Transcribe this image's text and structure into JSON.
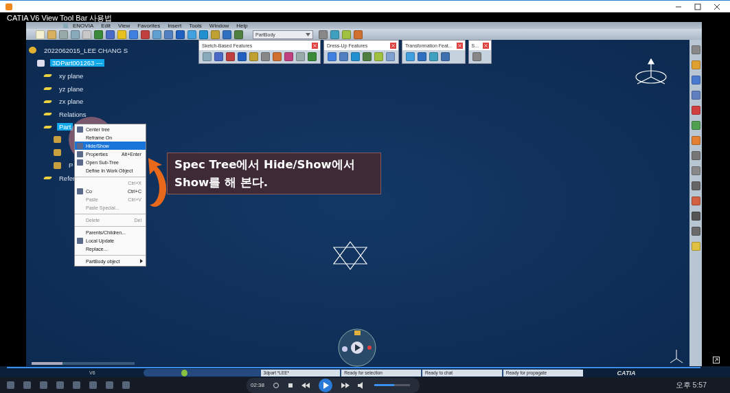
{
  "player": {
    "caption": "CATIA V6 View Tool Bar 사용법"
  },
  "menu_bar": [
    "ENOVIA",
    "Edit",
    "View",
    "Favorites",
    "Insert",
    "Tools",
    "Window",
    "Help"
  ],
  "toolbar": {
    "dropdown": "PartBody"
  },
  "floating_toolbars": [
    {
      "title": "Sketch-Based Features"
    },
    {
      "title": "Dress-Up Features"
    },
    {
      "title": "Transformation Feat..."
    },
    {
      "title": "S..."
    }
  ],
  "tree": {
    "label": "2022062015_LEE CHANG S",
    "selected": false,
    "children": [
      {
        "label": "3DPart001263 ---",
        "selected": true,
        "children": [
          {
            "label": "xy plane",
            "selected": false
          },
          {
            "label": "yz plane",
            "selected": false
          },
          {
            "label": "zx plane",
            "selected": false
          },
          {
            "label": "Relations",
            "selected": false
          },
          {
            "label": "Part",
            "selected": true,
            "children": [
              {
                "selected": false
              },
              {
                "selected": false
              },
              {
                "label": "P",
                "selected": false
              }
            ]
          },
          {
            "label": "Refer",
            "selected": false
          }
        ]
      }
    ]
  },
  "context_menu": [
    {
      "label": "Center tree",
      "icon": true,
      "selected": false,
      "disabled": false,
      "separator_before": false,
      "submenu": false
    },
    {
      "label": "Reframe On",
      "icon": false,
      "selected": false,
      "disabled": false,
      "separator_before": false,
      "submenu": false
    },
    {
      "label": "Hide/Show",
      "icon": true,
      "selected": true,
      "disabled": false,
      "separator_before": false,
      "submenu": false
    },
    {
      "label": "Properties",
      "shortcut": "Alt+Enter",
      "icon": true,
      "selected": false,
      "disabled": false,
      "separator_before": false,
      "submenu": false
    },
    {
      "label": "Open Sub-Tree",
      "icon": true,
      "selected": false,
      "disabled": false,
      "separator_before": false,
      "submenu": false
    },
    {
      "label": "Define In Work Object",
      "icon": false,
      "selected": false,
      "disabled": false,
      "separator_before": false,
      "submenu": false
    },
    {
      "shortcut": "Ctrl+X",
      "icon": false,
      "selected": false,
      "disabled": true,
      "separator_before": true,
      "submenu": false
    },
    {
      "label": "Co",
      "shortcut": "Ctrl+C",
      "icon": true,
      "selected": false,
      "disabled": false,
      "separator_before": false,
      "submenu": false
    },
    {
      "label": "Paste",
      "shortcut": "Ctrl+V",
      "icon": false,
      "selected": false,
      "disabled": true,
      "separator_before": false,
      "submenu": false
    },
    {
      "label": "Paste Special...",
      "icon": false,
      "selected": false,
      "disabled": true,
      "separator_before": false,
      "submenu": false
    },
    {
      "label": "Delete",
      "shortcut": "Del",
      "icon": false,
      "selected": false,
      "disabled": true,
      "separator_before": true,
      "submenu": false
    },
    {
      "label": "Parents/Children...",
      "icon": false,
      "selected": false,
      "disabled": false,
      "separator_before": true,
      "submenu": false
    },
    {
      "label": "Local Update",
      "icon": true,
      "selected": false,
      "disabled": false,
      "separator_before": false,
      "submenu": false
    },
    {
      "label": "Replace...",
      "icon": false,
      "selected": false,
      "disabled": false,
      "separator_before": false,
      "submenu": false
    },
    {
      "label": "PartBody object",
      "icon": false,
      "selected": false,
      "disabled": false,
      "separator_before": true,
      "submenu": true
    }
  ],
  "annotation": {
    "lines": [
      "Spec Tree에서 Hide/Show에서",
      "Show를 해 본다."
    ]
  },
  "status_bar": {
    "version": "V6",
    "segments": [
      "3dpart *LEE*",
      "Ready for selection",
      "Ready to chat",
      "Ready for propagate"
    ],
    "logo": "CATIA"
  },
  "playback": {
    "progress": {
      "level": 1
    },
    "time": "02:38",
    "volume": {
      "level": 0.55
    }
  },
  "taskbar": {
    "clock": "오후 5:57"
  }
}
